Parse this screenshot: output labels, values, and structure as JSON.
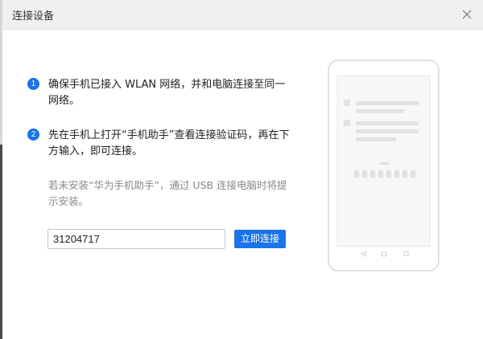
{
  "dialog": {
    "title": "连接设备",
    "close_icon": "close-icon"
  },
  "steps": [
    {
      "number": "1",
      "text": "确保手机已接入 WLAN 网络，并和电脑连接至同一网络。"
    },
    {
      "number": "2",
      "text": "先在手机上打开“手机助手”查看连接验证码，再在下方输入，即可连接。"
    }
  ],
  "hint": "若未安装“华为手机助手”，通过 USB 连接电脑时将提示安装。",
  "code_input": {
    "value": "31204717"
  },
  "connect_button": {
    "label": "立即连接"
  },
  "colors": {
    "accent": "#1a73e8",
    "titlebar": "#f0f0f0"
  },
  "illustration": {
    "icon": "phone-illustration"
  }
}
